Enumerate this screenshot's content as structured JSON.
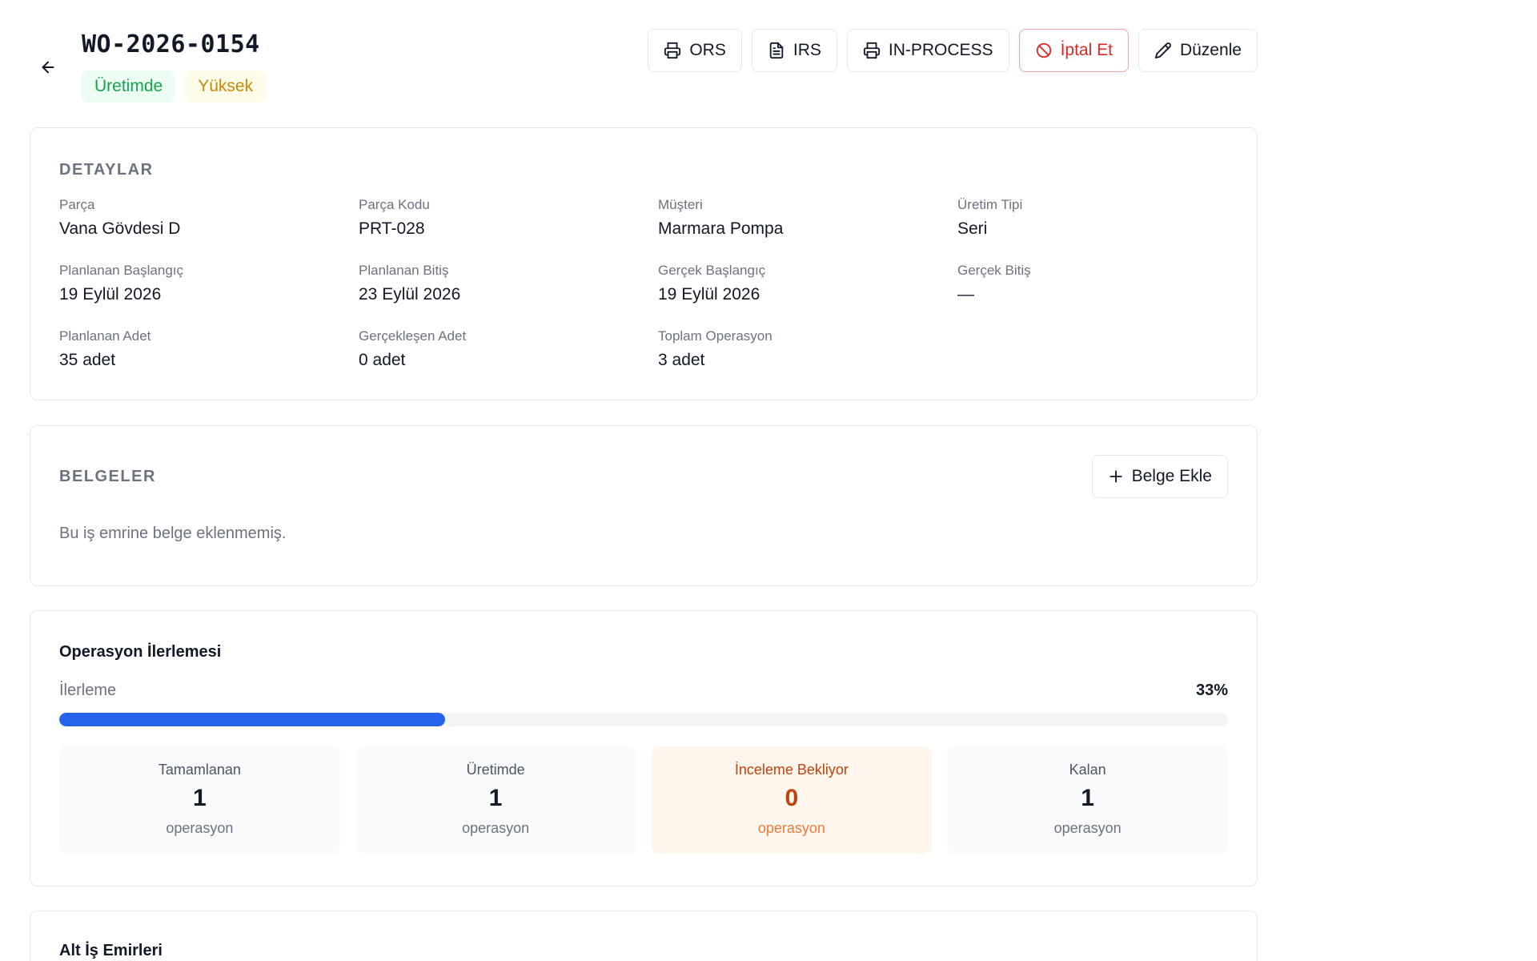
{
  "header": {
    "title": "WO-2026-0154",
    "status_badge": "Üretimde",
    "priority_badge": "Yüksek"
  },
  "actions": {
    "ors": "ORS",
    "irs": "IRS",
    "in_process": "IN-PROCESS",
    "cancel": "İptal Et",
    "edit": "Düzenle"
  },
  "details": {
    "heading": "DETAYLAR",
    "fields": [
      {
        "label": "Parça",
        "value": "Vana Gövdesi D"
      },
      {
        "label": "Parça Kodu",
        "value": "PRT-028"
      },
      {
        "label": "Müşteri",
        "value": "Marmara Pompa"
      },
      {
        "label": "Üretim Tipi",
        "value": "Seri"
      },
      {
        "label": "Planlanan Başlangıç",
        "value": "19 Eylül 2026"
      },
      {
        "label": "Planlanan Bitiş",
        "value": "23 Eylül 2026"
      },
      {
        "label": "Gerçek Başlangıç",
        "value": "19 Eylül 2026"
      },
      {
        "label": "Gerçek Bitiş",
        "value": "—"
      },
      {
        "label": "Planlanan Adet",
        "value": "35 adet"
      },
      {
        "label": "Gerçekleşen Adet",
        "value": "0 adet"
      },
      {
        "label": "Toplam Operasyon",
        "value": "3 adet"
      }
    ]
  },
  "documents": {
    "heading": "BELGELER",
    "add_button": "Belge Ekle",
    "empty_message": "Bu iş emrine belge eklenmemiş."
  },
  "progress": {
    "title": "Operasyon İlerlemesi",
    "label": "İlerleme",
    "percent_text": "33%",
    "fraction": 0.33,
    "stats": [
      {
        "label": "Tamamlanan",
        "value": "1",
        "unit": "operasyon"
      },
      {
        "label": "Üretimde",
        "value": "1",
        "unit": "operasyon"
      },
      {
        "label": "İnceleme Bekliyor",
        "value": "0",
        "unit": "operasyon"
      },
      {
        "label": "Kalan",
        "value": "1",
        "unit": "operasyon"
      }
    ]
  },
  "sub_orders": {
    "title": "Alt İş Emirleri"
  },
  "colors": {
    "accent": "#2563eb",
    "status_green": "#16a34a",
    "priority_yellow": "#c68a0a",
    "danger": "#dc2626",
    "warning": "#c2410c"
  },
  "icons": {
    "back": "arrow-left-icon",
    "print": "printer-icon",
    "document": "file-text-icon",
    "cancel": "ban-icon",
    "edit": "pencil-icon",
    "add": "plus-icon"
  }
}
